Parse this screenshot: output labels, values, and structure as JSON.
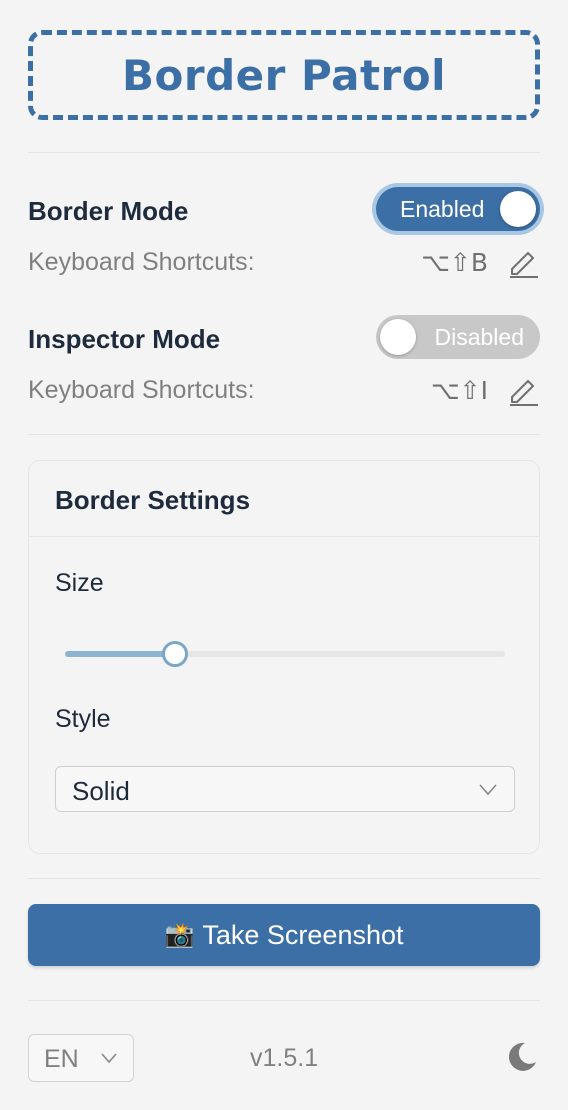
{
  "app": {
    "title": "Border Patrol"
  },
  "border_mode": {
    "label": "Border Mode",
    "toggle_label": "Enabled",
    "enabled": true,
    "shortcut_label": "Keyboard Shortcuts:",
    "shortcut_keys": "⌥⇧B",
    "edit_icon": "pencil-icon"
  },
  "inspector_mode": {
    "label": "Inspector Mode",
    "toggle_label": "Disabled",
    "enabled": false,
    "shortcut_label": "Keyboard Shortcuts:",
    "shortcut_keys": "⌥⇧I",
    "edit_icon": "pencil-icon"
  },
  "border_settings": {
    "title": "Border Settings",
    "size_label": "Size",
    "size_fraction": 0.25,
    "style_label": "Style",
    "style_value": "Solid"
  },
  "screenshot_button": {
    "icon": "camera-flash-icon",
    "label": "Take Screenshot"
  },
  "footer": {
    "language": "EN",
    "version": "v1.5.1",
    "theme_icon": "moon-icon"
  },
  "colors": {
    "accent": "#3c6fa6",
    "accent_ring": "#a8c7e3",
    "toggle_off": "#c8c8c8",
    "background": "#f4f4f4",
    "slider_fill": "#8fb4cf"
  }
}
